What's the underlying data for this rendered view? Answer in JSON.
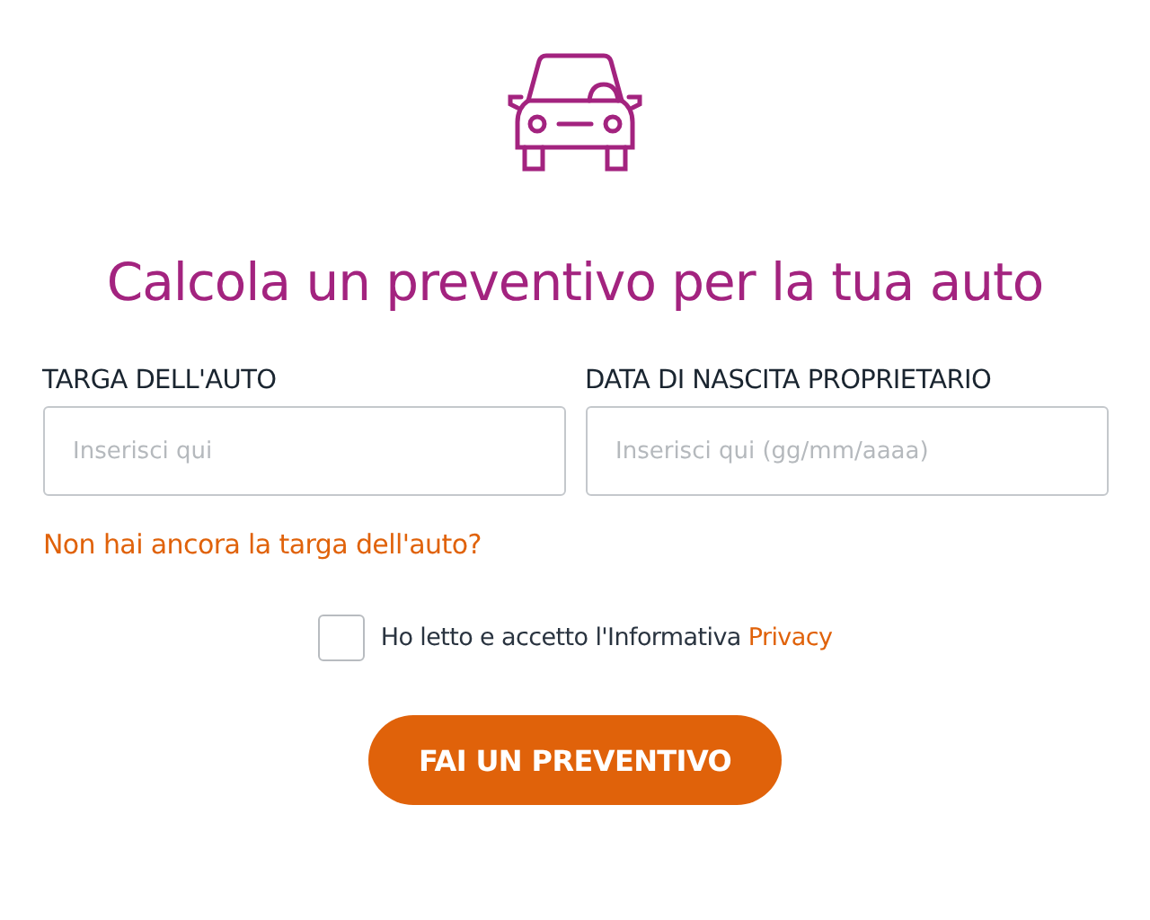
{
  "title": "Calcola un preventivo per la tua auto",
  "fields": [
    {
      "label": "TARGA DELL'AUTO",
      "placeholder": "Inserisci qui"
    },
    {
      "label": "DATA DI NASCITA PROPRIETARIO",
      "placeholder": "Inserisci qui (gg/mm/aaaa)"
    }
  ],
  "help_link": "Non hai ancora la targa dell'auto?",
  "consent": {
    "text": "Ho letto e accetto l'Informativa",
    "link": "Privacy",
    "checked": false
  },
  "button": "FAI UN PREVENTIVO"
}
